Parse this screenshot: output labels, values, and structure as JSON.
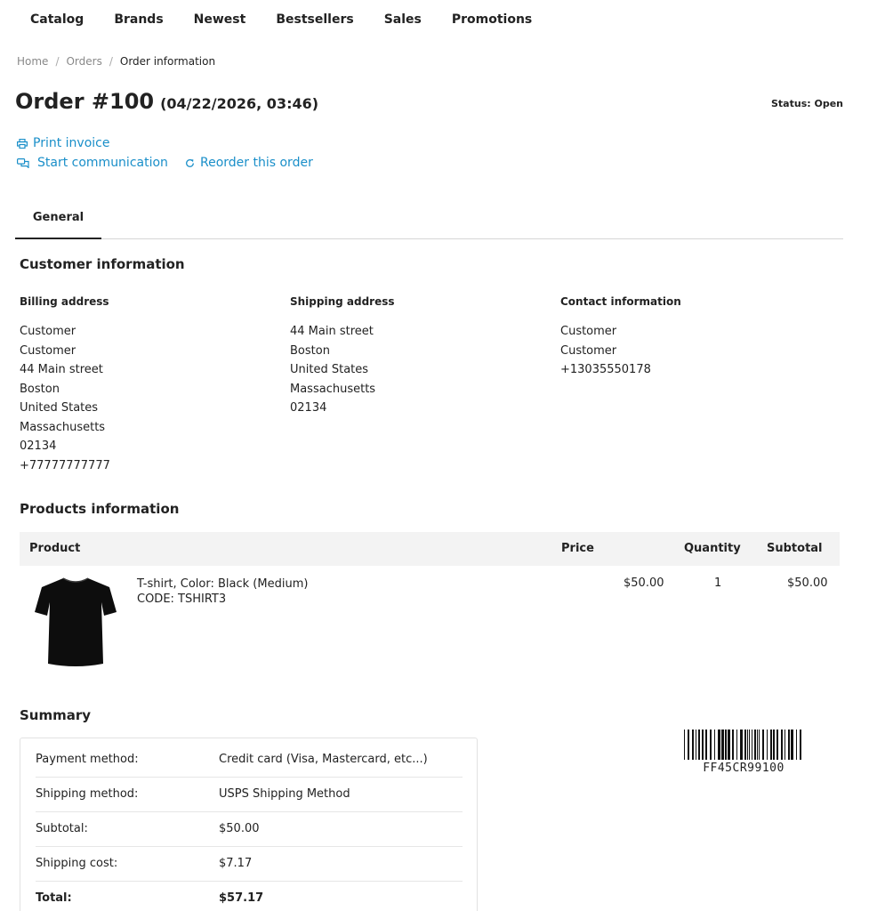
{
  "nav": {
    "items": [
      "Catalog",
      "Brands",
      "Newest",
      "Bestsellers",
      "Sales",
      "Promotions"
    ]
  },
  "breadcrumb": {
    "items": [
      "Home",
      "Orders"
    ],
    "current": "Order information"
  },
  "order": {
    "title": "Order #100",
    "date": "(04/22/2026, 03:46)",
    "status": "Status: Open"
  },
  "actions": {
    "print": "Print invoice",
    "communicate": "Start communication",
    "reorder": "Reorder this order"
  },
  "tabs": {
    "general": "General"
  },
  "customer": {
    "heading": "Customer information",
    "billing": {
      "heading": "Billing address",
      "lines": [
        "Customer",
        "Customer",
        "44 Main street",
        "Boston",
        "United States",
        "Massachusetts",
        "02134",
        "+77777777777"
      ]
    },
    "shipping": {
      "heading": "Shipping address",
      "lines": [
        "44 Main street",
        "Boston",
        "United States",
        "Massachusetts",
        "02134"
      ]
    },
    "contact": {
      "heading": "Contact information",
      "lines": [
        "Customer",
        "Customer",
        "+13035550178"
      ]
    }
  },
  "products": {
    "heading": "Products information",
    "columns": [
      "Product",
      "Price",
      "Quantity",
      "Subtotal"
    ],
    "rows": [
      {
        "name": "T-shirt, Color: Black (Medium)",
        "code": "CODE: TSHIRT3",
        "price": "$50.00",
        "quantity": "1",
        "subtotal": "$50.00"
      }
    ]
  },
  "summary": {
    "heading": "Summary",
    "rows": [
      {
        "label": "Payment method:",
        "value": "Credit card (Visa, Mastercard, etc...)"
      },
      {
        "label": "Shipping method:",
        "value": "USPS Shipping Method"
      },
      {
        "label": "Subtotal:",
        "value": "$50.00"
      },
      {
        "label": "Shipping cost:",
        "value": "$7.17"
      },
      {
        "label": "Total:",
        "value": "$57.17"
      }
    ]
  },
  "barcode": {
    "text": "FF45CR99100"
  },
  "colors": {
    "link": "#1a8fc9",
    "text": "#222222",
    "table_header_bg": "#f3f3f3"
  }
}
